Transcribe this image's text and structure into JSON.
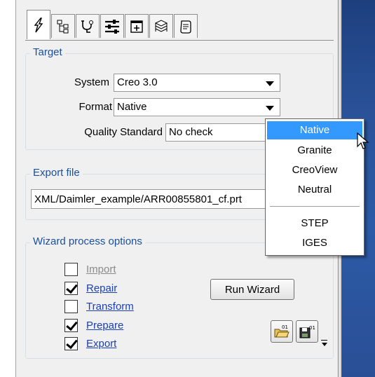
{
  "tabs": [
    {
      "icon": "lightning-icon",
      "active": true
    },
    {
      "icon": "tree-structure-icon",
      "active": false
    },
    {
      "icon": "stethoscope-icon",
      "active": false
    },
    {
      "icon": "tools-icon",
      "active": false
    },
    {
      "icon": "add-window-icon",
      "active": false
    },
    {
      "icon": "layers-stack-icon",
      "active": false
    },
    {
      "icon": "script-scroll-icon",
      "active": false
    }
  ],
  "target": {
    "legend": "Target",
    "system_label": "System",
    "system_value": "Creo 3.0",
    "format_label": "Format",
    "format_value": "Native",
    "quality_label": "Quality Standard",
    "quality_value": "No check"
  },
  "export_file": {
    "legend": "Export file",
    "path": "XML/Daimler_example/ARR00855801_cf.prt"
  },
  "wizard": {
    "legend": "Wizard process options",
    "options": [
      {
        "label": "Import",
        "checked": false,
        "enabled": false
      },
      {
        "label": "Repair",
        "checked": true,
        "enabled": true
      },
      {
        "label": "Transform",
        "checked": false,
        "enabled": true
      },
      {
        "label": "Prepare",
        "checked": true,
        "enabled": true
      },
      {
        "label": "Export",
        "checked": true,
        "enabled": true
      }
    ],
    "run_button": "Run Wizard",
    "load_icon": "open-folder-icon",
    "save_icon": "save-disk-icon"
  },
  "format_dropdown": {
    "items": [
      "Native",
      "Granite",
      "CreoView",
      "Neutral",
      "STEP",
      "IGES"
    ],
    "selected": "Native"
  },
  "colors": {
    "accent_blue": "#1a4f9c",
    "selection": "#3399ff",
    "link": "#1a3fb5",
    "frame_blue": "#2a5299"
  }
}
